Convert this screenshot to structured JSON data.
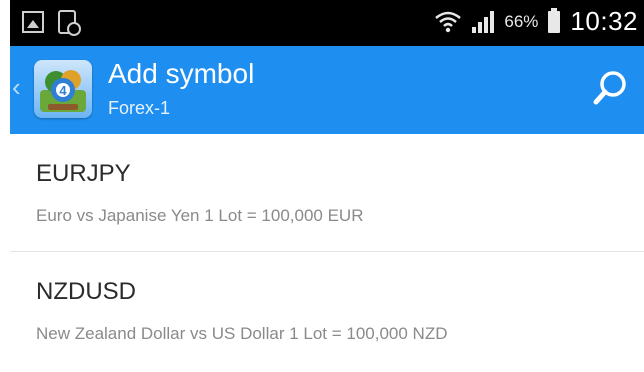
{
  "status_bar": {
    "battery_percent": "66%",
    "time": "10:32",
    "left_icons": [
      "gallery-icon",
      "device-icon"
    ],
    "right_icons": [
      "wifi-icon",
      "signal-icon",
      "battery-icon"
    ]
  },
  "app_bar": {
    "title": "Add symbol",
    "subtitle": "Forex-1",
    "back_icon": "chevron-left-icon",
    "logo_icon": "metatrader-logo",
    "search_icon": "search-icon",
    "background_color": "#1e8ff0"
  },
  "symbols": [
    {
      "name": "EURJPY",
      "description": "Euro vs Japanise Yen 1 Lot = 100,000 EUR"
    },
    {
      "name": "NZDUSD",
      "description": "New Zealand Dollar vs US Dollar 1 Lot = 100,000 NZD"
    }
  ]
}
